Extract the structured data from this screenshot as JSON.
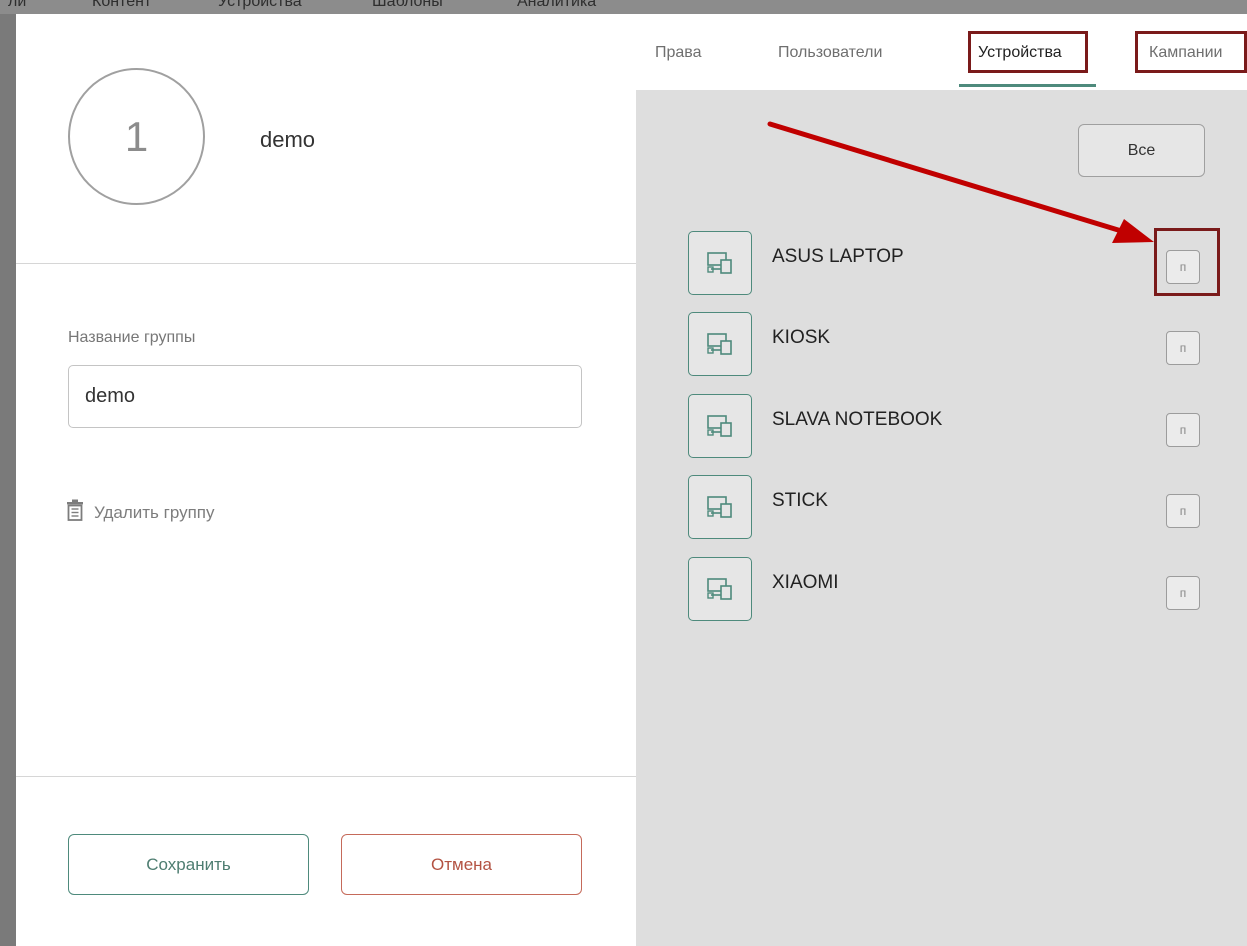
{
  "background_nav": [
    "Контент",
    "Устройства",
    "Шаблоны",
    "Аналитика"
  ],
  "group": {
    "avatar_text": "1",
    "name": "demo"
  },
  "form": {
    "label": "Название группы",
    "value": "demo",
    "delete_label": "Удалить группу",
    "save_label": "Сохранить",
    "cancel_label": "Отмена"
  },
  "tabs": [
    {
      "label": "Права"
    },
    {
      "label": "Пользователи"
    },
    {
      "label": "Устройства",
      "active": true
    },
    {
      "label": "Кампании"
    }
  ],
  "devices_panel": {
    "all_label": "Все",
    "check_label": "п",
    "items": [
      {
        "name": "ASUS LAPTOP",
        "highlighted": true
      },
      {
        "name": "KIOSK"
      },
      {
        "name": "SLAVA NOTEBOOK"
      },
      {
        "name": "STICK"
      },
      {
        "name": "XIAOMI"
      }
    ]
  },
  "colors": {
    "accent": "#4e8a7c",
    "cancel": "#b35242",
    "annotation": "#7a1a1a",
    "arrow": "#c00000",
    "panel_bg": "#dedede"
  }
}
